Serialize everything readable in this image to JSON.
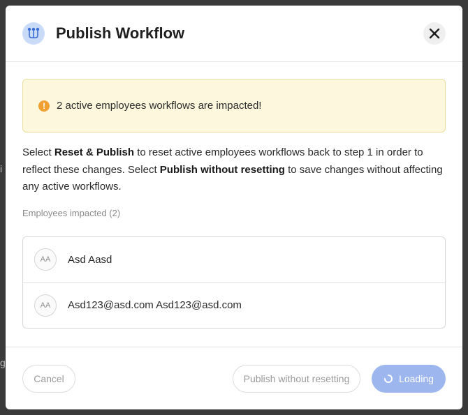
{
  "backdrop": {
    "fragment_1": "i",
    "fragment_2": "g"
  },
  "modal": {
    "title": "Publish Workflow",
    "icon": "workflow-icon",
    "close_icon": "close-icon"
  },
  "alert": {
    "icon": "exclamation-icon",
    "text": "2 active employees workflows are impacted!"
  },
  "description": {
    "part1": "Select ",
    "bold1": "Reset & Publish",
    "part2": " to reset active employees workflows back to step 1 in order to reflect these changes. Select ",
    "bold2": "Publish without resetting",
    "part3": " to save changes without affecting any active workflows."
  },
  "employees": {
    "label": "Employees impacted (2)",
    "items": [
      {
        "initials": "AA",
        "name": "Asd Aasd"
      },
      {
        "initials": "AA",
        "name": "Asd123@asd.com Asd123@asd.com"
      }
    ]
  },
  "footer": {
    "cancel_label": "Cancel",
    "secondary_label": "Publish without resetting",
    "primary_label": "Loading",
    "spinner_icon": "spinner-icon"
  },
  "colors": {
    "primary": "#9db7ee",
    "alert_bg": "#fdf8dd",
    "alert_icon": "#f0a031",
    "header_icon_bg": "#c9dbf7"
  }
}
